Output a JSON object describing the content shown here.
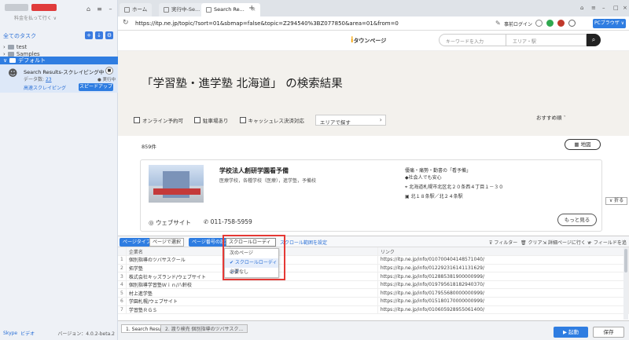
{
  "sidebar": {
    "account_sub": "料金を払って行く ∨",
    "all_tasks": "全てのタスク",
    "tree": [
      {
        "label": "test"
      },
      {
        "label": "Samples"
      },
      {
        "label": "デフォルト"
      }
    ],
    "task": {
      "title": "Search Results-スクレイピング中",
      "data_label": "データ数:",
      "data_count": "23",
      "running": "● 実行中",
      "mode": "高速スクレイピング",
      "speed_label": "スピードアップ"
    },
    "footer": {
      "skype": "Skype",
      "chat": "ビデオ",
      "version": "バージョン：4.0.2-beta.2"
    }
  },
  "browser": {
    "tabs": [
      {
        "label": "ホーム"
      },
      {
        "label": "実行中-Se..."
      },
      {
        "label": "Search Re..."
      }
    ],
    "new_tab": "+",
    "url": "https://itp.ne.jp/topic/?sort=01&sbmap=false&topic=Z294540%3BZ077850&area=01&from=0",
    "pre_login": "事前ログイン",
    "pc_browser": "PCブラウザ ∨"
  },
  "site": {
    "logo": "タウンページ",
    "logo_mark": "i",
    "keyword_placeholder": "キーワードを入力",
    "area_placeholder": "エリア・駅",
    "heading": "「学習塾・進学塾 北海道」 の検索結果",
    "filters": [
      "オンライン予約可",
      "駐車場あり",
      "キャッシュレス決済対応"
    ],
    "area_search": "エリアで探す",
    "sort": "おすすめ順",
    "count": "859件",
    "map": "地図",
    "card": {
      "name": "学校法人創研学園看予備",
      "category": "医療学校，各種学校（医療），進学塾，予備校",
      "line1": "優痛・痛勢・勤書の「看予備」",
      "line2": "◆社会人でも安心",
      "address": "北海道札幌市北区北２０条西４丁目１－３０",
      "station": "北１８条駅／北２４条駅",
      "website": "ウェブサイト",
      "tel": "011-758-5959",
      "more": "もっと見る"
    },
    "fold": "∨ 折る"
  },
  "datapane": {
    "list_type": "ページタイプ",
    "page_select": "ページで選択",
    "page_set": "ページ番号の設定",
    "scroll_select": "スクロールローディン ▾",
    "scroll_link": "スクロール範囲を設定",
    "filter": "フィルター",
    "clear": "クリア",
    "goto": "詳細ページに行く ∨",
    "add_field": "+ フィールドを追加",
    "dropdown": [
      "次のページ",
      "✔ スクロールローディング",
      "必要なし"
    ],
    "headers": [
      "",
      "企業名",
      "リンク"
    ],
    "rows": [
      {
        "idx": "1",
        "name": "個別指導のツバサスクール",
        "link": "https://itp.ne.jp/info/010700404148571040/"
      },
      {
        "idx": "2",
        "name": "拓学塾",
        "link": "https://itp.ne.jp/info/012292316141131629/"
      },
      {
        "idx": "3",
        "name": "株式会社キッズランド/ウェブサイト",
        "link": "https://itp.ne.jp/info/012885381900000999/"
      },
      {
        "idx": "4",
        "name": "個別指導学習塾Ｗｉｎ/八軒校",
        "link": "https://itp.ne.jp/info/019795618182940370/"
      },
      {
        "idx": "5",
        "name": "村上進学塾",
        "link": "https://itp.ne.jp/info/017955680000000999/"
      },
      {
        "idx": "6",
        "name": "学園札幌/ウェブサイト",
        "link": "https://itp.ne.jp/info/015180170000000999/"
      },
      {
        "idx": "7",
        "name": "学習塾ＲＧＳ",
        "link": "https://itp.ne.jp/info/010605928955061400/"
      }
    ],
    "bottom_tabs": [
      "1. Search Results",
      "2. 渡り検売 個別指導のツバサスク..."
    ],
    "start": "▶ 起動",
    "save": "保存"
  }
}
